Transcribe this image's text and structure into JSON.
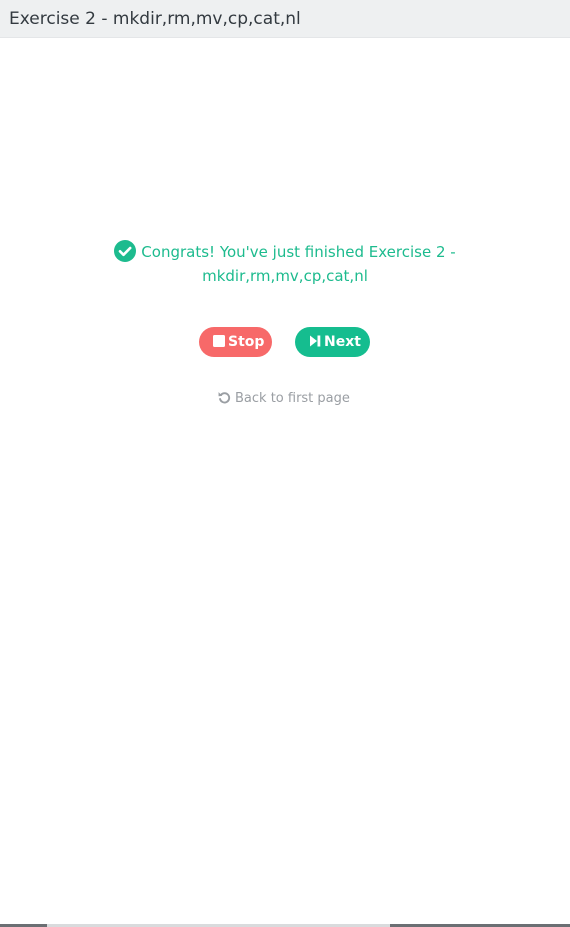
{
  "header": {
    "title": "Exercise 2 - mkdir,rm,mv,cp,cat,nl"
  },
  "message": {
    "icon": "check-circle-icon",
    "line1": "Congrats! You've just finished Exercise 2 -",
    "line2": "mkdir,rm,mv,cp,cat,nl"
  },
  "buttons": {
    "stop": {
      "label": "Stop",
      "icon": "stop-icon",
      "color": "#f76969"
    },
    "next": {
      "label": "Next",
      "icon": "step-forward-icon",
      "color": "#15bd8f"
    }
  },
  "back_link": {
    "label": "Back to first page",
    "icon": "undo-icon"
  },
  "colors": {
    "success": "#1dbb8e",
    "header_bg": "#eef0f1",
    "muted_text": "#9a9ea3"
  }
}
